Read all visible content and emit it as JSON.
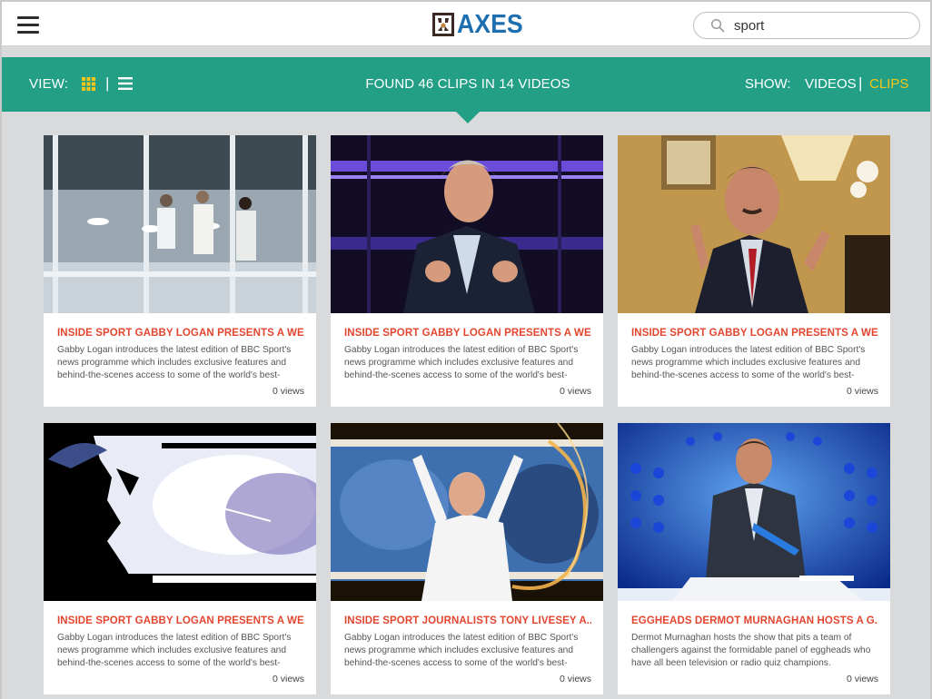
{
  "header": {
    "logo_text": "AXES",
    "search_value": "sport",
    "search_placeholder": ""
  },
  "toolbar": {
    "view_label": "VIEW:",
    "separator": "|",
    "found_text": "FOUND 46 CLIPS IN 14 VIDEOS",
    "show_label": "SHOW:",
    "videos_label": "VIDEOS",
    "clips_label": "CLIPS"
  },
  "colors": {
    "accent_green": "#239f86",
    "active_yellow": "#f5c518",
    "title_red": "#e2462f",
    "logo_blue": "#1e6fb0"
  },
  "cards": [
    {
      "title": "INSIDE SPORT GABBY LOGAN PRESENTS A WE...",
      "description": "Gabby Logan introduces the latest edition of BBC Sport's news programme which includes exclusive features and behind-the-scenes access to some of the world's best-",
      "views": "0 views",
      "thumbnail": "commentary-box-scene"
    },
    {
      "title": "INSIDE SPORT GABBY LOGAN PRESENTS A WE...",
      "description": "Gabby Logan introduces the latest edition of BBC Sport's news programme which includes exclusive features and behind-the-scenes access to some of the world's best-",
      "views": "0 views",
      "thumbnail": "studio-presenter"
    },
    {
      "title": "INSIDE SPORT GABBY LOGAN PRESENTS A WE...",
      "description": "Gabby Logan introduces the latest edition of BBC Sport's news programme which includes exclusive features and behind-the-scenes access to some of the world's best-",
      "views": "0 views",
      "thumbnail": "interview-man-gesturing"
    },
    {
      "title": "INSIDE SPORT GABBY LOGAN PRESENTS A WE...",
      "description": "Gabby Logan introduces the latest edition of BBC Sport's news programme which includes exclusive features and behind-the-scenes access to some of the world's best-",
      "views": "0 views",
      "thumbnail": "silhouette-flare"
    },
    {
      "title": "INSIDE SPORT JOURNALISTS TONY LIVESEY A...",
      "description": "Gabby Logan introduces the latest edition of BBC Sport's news programme which includes exclusive features and behind-the-scenes access to some of the world's best-",
      "views": "0 views",
      "thumbnail": "celebration-montage"
    },
    {
      "title": "EGGHEADS DERMOT MURNAGHAN HOSTS A G...",
      "description": "Dermot Murnaghan hosts the show that pits a team of challengers against the formidable panel of eggheads who have all been television or radio quiz champions.",
      "views": "0 views",
      "thumbnail": "quiz-show-host"
    }
  ]
}
